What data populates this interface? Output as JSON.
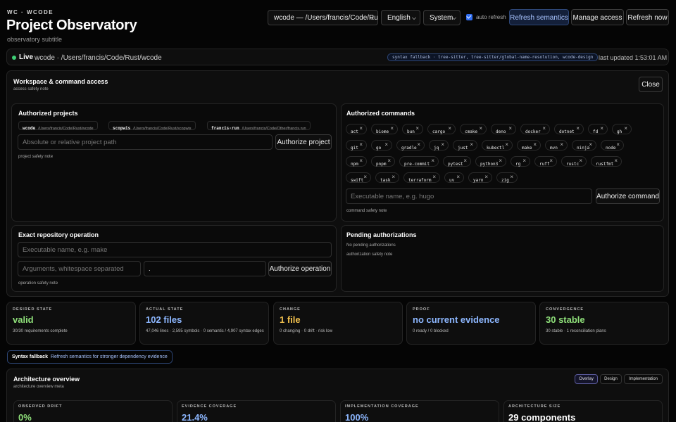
{
  "header": {
    "kicker": "WC · WCODE",
    "title": "Project Observatory",
    "subtitle": "observatory subtitle"
  },
  "controls": {
    "project_select": "wcode — /Users/francis/Code/Rust/wcode",
    "language_select": "English",
    "theme_select": "System",
    "auto_refresh_label": "auto refresh",
    "auto_refresh_checked": true,
    "refresh_semantics": "Refresh semantics",
    "manage_access": "Manage access",
    "refresh_now": "Refresh now"
  },
  "live": {
    "label": "Live",
    "path": "wcode · /Users/francis/Code/Rust/wcode",
    "syntax_badge": "syntax fallback · tree-sitter, tree-sitter/global-name-resolution, wcode-design",
    "updated": "last updated 1:53:01 AM"
  },
  "access": {
    "title": "Workspace & command access",
    "note": "access safety note",
    "close": "Close",
    "projects": {
      "title": "Authorized projects",
      "items": [
        {
          "name": "wcode",
          "path": "/Users/francis/Code/Rust/wcode"
        },
        {
          "name": "scopwis",
          "path": "/Users/francis/Code/Rust/scopwis"
        },
        {
          "name": "francis-run",
          "path": "/Users/francis/Code/Other/francis.run"
        }
      ],
      "placeholder": "Absolute or relative project path",
      "button": "Authorize project",
      "note": "project safety note"
    },
    "commands": {
      "title": "Authorized commands",
      "items": [
        "act",
        "biome",
        "bun",
        "cargo",
        "cmake",
        "deno",
        "docker",
        "dotnet",
        "fd",
        "gh",
        "git",
        "go",
        "gradle",
        "jq",
        "just",
        "kubectl",
        "make",
        "mvn",
        "ninja",
        "node",
        "npm",
        "pnpm",
        "pre-commit",
        "pytest",
        "python3",
        "rg",
        "ruff",
        "rustc",
        "rustfmt",
        "swift",
        "task",
        "terraform",
        "uv",
        "yarn",
        "zig"
      ],
      "remove_glyph": "×",
      "placeholder": "Executable name, e.g. hugo",
      "button": "Authorize command",
      "note": "command safety note"
    },
    "operation": {
      "title": "Exact repository operation",
      "exec_placeholder": "Executable name, e.g. make",
      "args_placeholder": "Arguments, whitespace separated",
      "cwd_value": ".",
      "button": "Authorize operation",
      "note": "operation safety note"
    },
    "pending": {
      "title": "Pending authorizations",
      "empty": "No pending authorizations",
      "note": "authorization safety note"
    }
  },
  "stats": [
    {
      "label": "DESIRED STATE",
      "value": "valid",
      "sub": "30/30 requirements complete",
      "color": "#8fe07a"
    },
    {
      "label": "ACTUAL STATE",
      "value": "102 files",
      "sub": "47,046 lines · 2,595 symbols · 0 semantic / 4,907 syntax edges",
      "color": "#8db7ff"
    },
    {
      "label": "CHANGE",
      "value": "1 file",
      "sub": "0 changing · 0 drift · risk low",
      "color": "#f2c14e"
    },
    {
      "label": "PROOF",
      "value": "no current evidence",
      "sub": "0 ready / 0 blocked",
      "color": "#8db7ff"
    },
    {
      "label": "CONVERGENCE",
      "value": "30 stable",
      "sub": "30 stable · 1 reconciliation plans",
      "color": "#8fe07a"
    }
  ],
  "hint": {
    "title": "Syntax fallback",
    "text": "Refresh semantics for stronger dependency evidence"
  },
  "architecture": {
    "title": "Architecture overview",
    "meta": "architecture overview meta",
    "tabs": [
      "Overlay",
      "Design",
      "Implementation"
    ],
    "metrics": [
      {
        "label": "OBSERVED DRIFT",
        "value": "0%",
        "color": "#8fe07a"
      },
      {
        "label": "EVIDENCE COVERAGE",
        "value": "21.4%",
        "color": "#8db7ff"
      },
      {
        "label": "IMPLEMENTATION COVERAGE",
        "value": "100%",
        "color": "#8db7ff"
      },
      {
        "label": "ARCHITECTURE SIZE",
        "value": "29 components",
        "color": "#ffffff"
      }
    ]
  }
}
